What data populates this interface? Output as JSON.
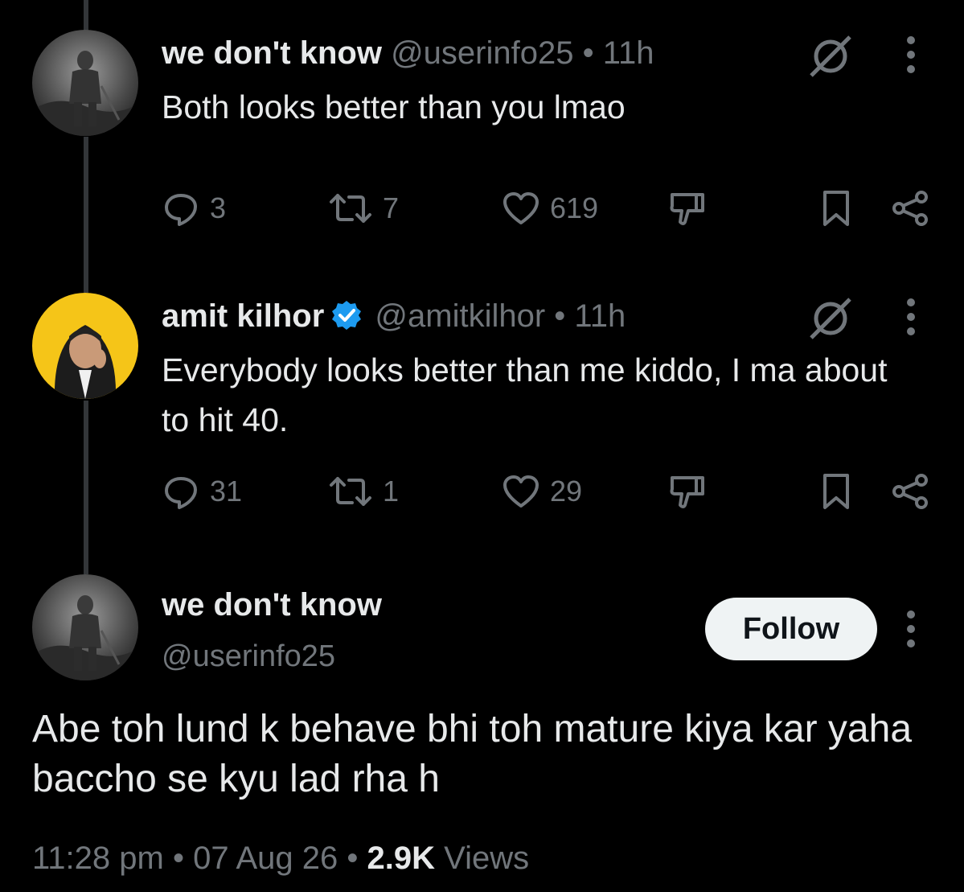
{
  "replies": [
    {
      "name": "we don't know",
      "handle": "@userinfo25",
      "separator": "•",
      "time": "11h",
      "text": "Both looks better than you lmao",
      "replies_count": "3",
      "reposts_count": "7",
      "likes_count": "619"
    },
    {
      "name": "amit kilhor",
      "verified": true,
      "handle": "@amitkilhor",
      "separator": "•",
      "time": "11h",
      "text": "Everybody looks better than me kiddo, I ma about to hit 40.",
      "replies_count": "31",
      "reposts_count": "1",
      "likes_count": "29"
    }
  ],
  "main_post": {
    "name": "we don't know",
    "handle": "@userinfo25",
    "follow_label": "Follow",
    "text": "Abe toh lund k behave bhi toh mature kiya kar yaha baccho se kyu lad rha h",
    "time": "11:28 pm",
    "separator": "•",
    "date": "07 Aug 26",
    "views_count": "2.9K",
    "views_label": "Views"
  },
  "colors": {
    "background": "#000000",
    "text": "#e7e9ea",
    "muted": "#71767b",
    "verified": "#1d9bf0",
    "avatar2_bg": "#f5c518"
  },
  "icons": [
    "reply-icon",
    "repost-icon",
    "like-icon",
    "dislike-icon",
    "bookmark-icon",
    "share-icon",
    "grok-icon",
    "more-icon",
    "verified-badge-icon"
  ]
}
